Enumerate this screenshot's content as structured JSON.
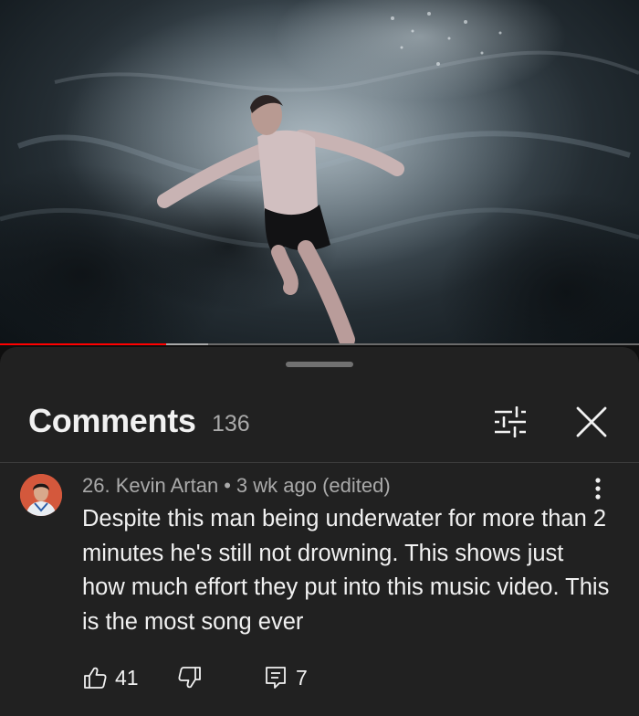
{
  "player": {
    "progress_played": 0.26,
    "progress_buffered": 0.325,
    "accent_color": "#ff0000"
  },
  "comments_panel": {
    "title": "Comments",
    "count": "136",
    "icons": {
      "filter": "sort-filter-icon",
      "close": "close-icon"
    }
  },
  "comment": {
    "author": "26. Kevin Artan",
    "separator": "•",
    "timestamp": "3 wk ago (edited)",
    "text": "Despite this man being underwater for more than 2 minutes he's still not drowning. This shows just how much effort they put into this music video. This is the most song ever",
    "likes": "41",
    "replies": "7",
    "icons": {
      "like": "thumbs-up-icon",
      "dislike": "thumbs-down-icon",
      "reply": "reply-comment-icon",
      "more": "more-vertical-icon"
    }
  }
}
